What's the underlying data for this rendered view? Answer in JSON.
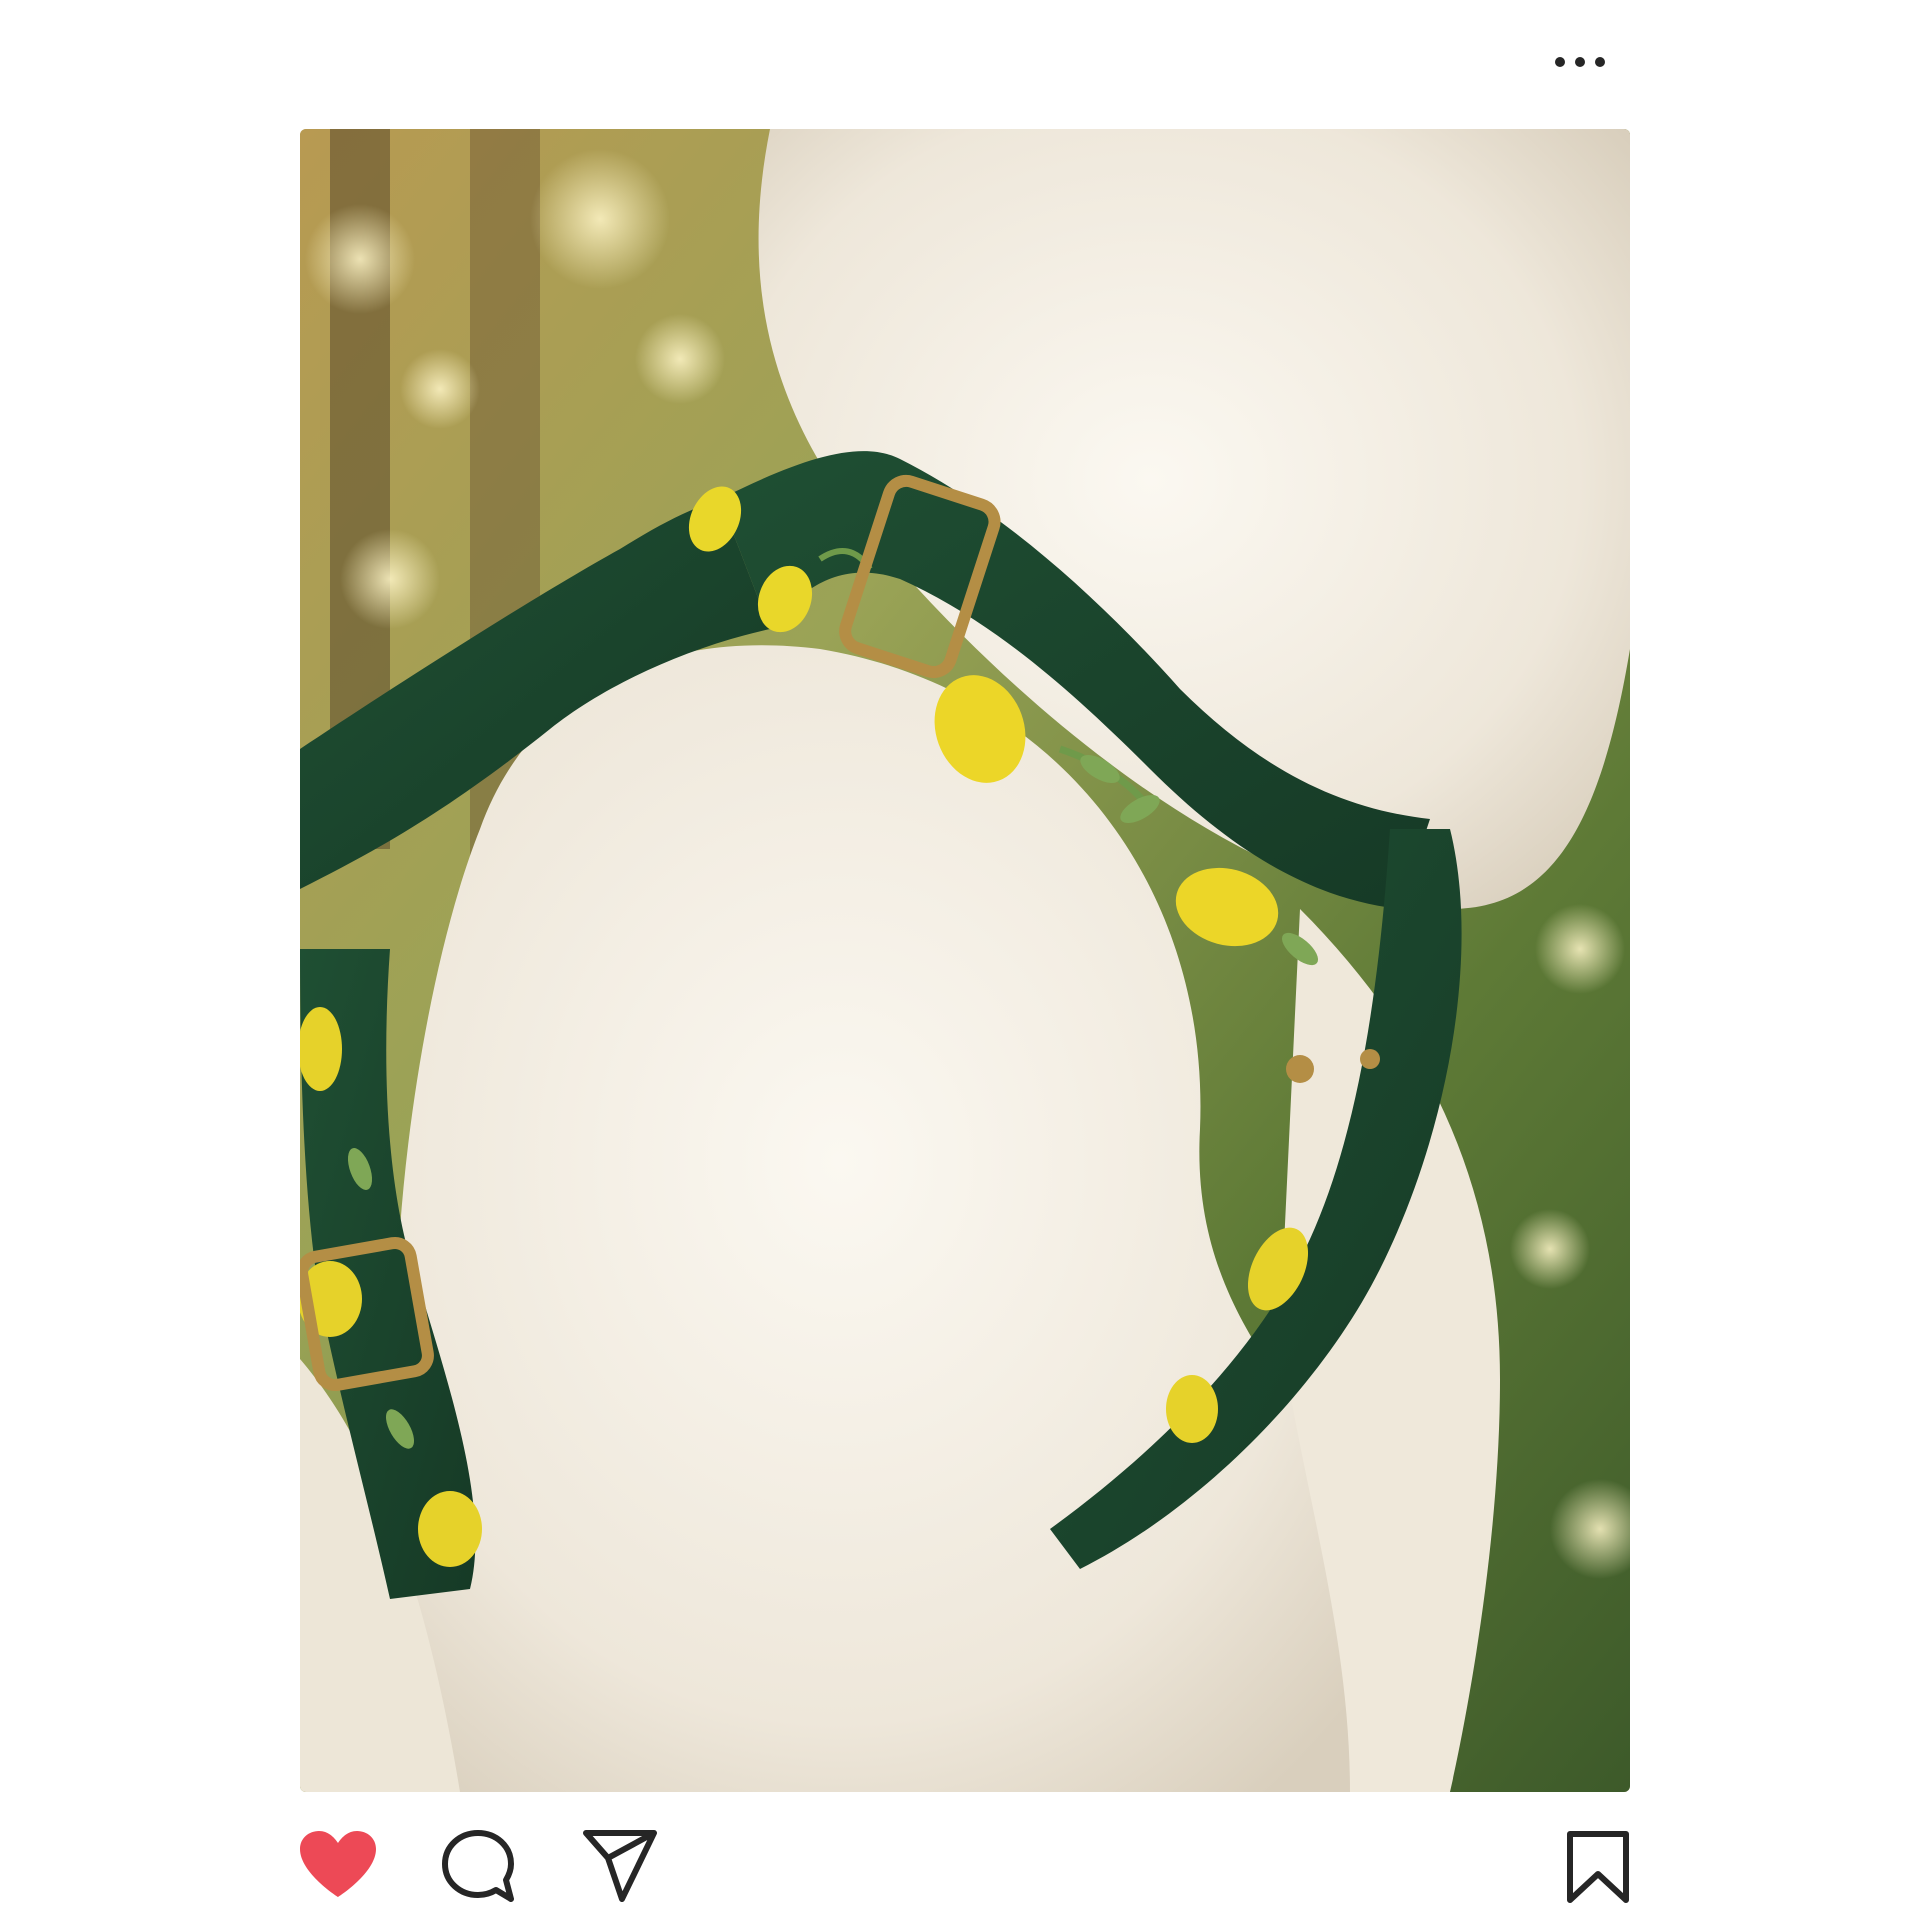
{
  "post": {
    "header": {
      "more_icon": "more-horizontal-icon"
    },
    "media": {
      "kind": "photo"
    },
    "actions": {
      "like": {
        "icon": "heart-icon",
        "liked": true,
        "color": "#ED4956"
      },
      "comment": {
        "icon": "comment-icon"
      },
      "share": {
        "icon": "send-icon"
      },
      "save": {
        "icon": "bookmark-icon"
      }
    }
  }
}
